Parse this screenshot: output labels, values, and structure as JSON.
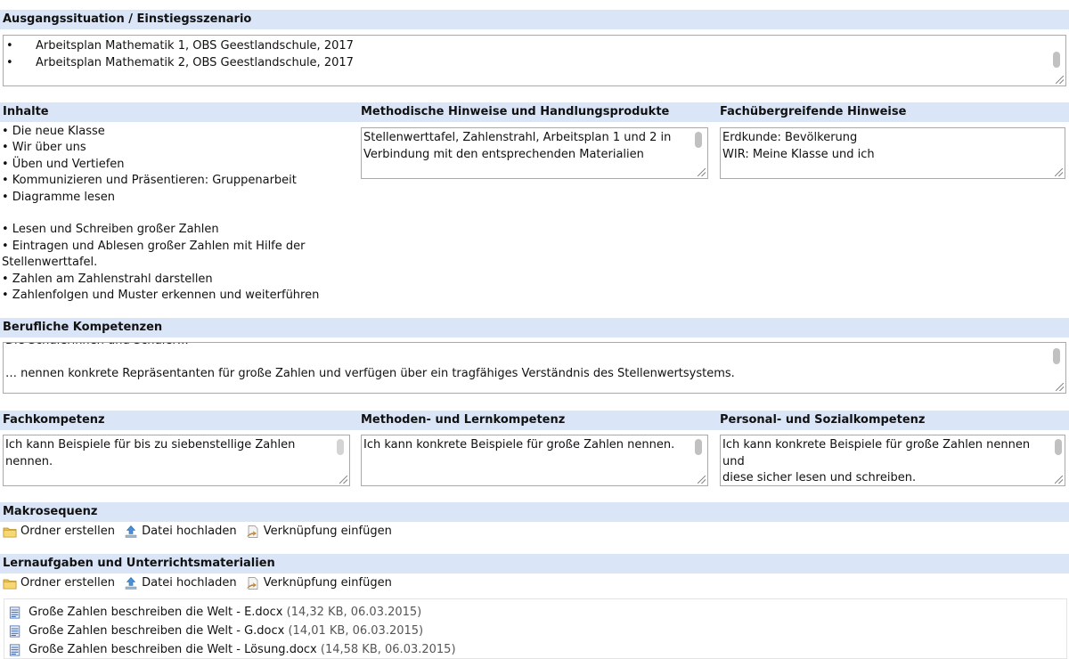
{
  "sections": {
    "ausgang": {
      "title": "Ausgangssituation / Einstiegsszenario",
      "items": [
        "Arbeitsplan Mathematik 1, OBS Geestlandschule, 2017",
        "Arbeitsplan Mathematik 2, OBS Geestlandschule, 2017"
      ]
    },
    "inhalte": {
      "title": "Inhalte",
      "lines": [
        "• Die neue Klasse",
        "• Wir über uns",
        "• Üben und Vertiefen",
        "• Kommunizieren und Präsentieren: Gruppenarbeit",
        "• Diagramme lesen",
        "",
        "• Lesen und Schreiben großer Zahlen",
        "• Eintragen und Ablesen großer Zahlen mit Hilfe der",
        "Stellenwerttafel.",
        "• Zahlen am Zahlenstrahl darstellen",
        "• Zahlenfolgen und Muster erkennen und weiterführen"
      ]
    },
    "methodisch": {
      "title": "Methodische Hinweise und Handlungsprodukte",
      "lines": [
        "Stellenwerttafel, Zahlenstrahl, Arbeitsplan 1 und 2 in",
        "Verbindung mit den entsprechenden Materialien"
      ]
    },
    "fachuebergreifend": {
      "title": "Fachübergreifende Hinweise",
      "lines": [
        "Erdkunde: Bevölkerung",
        "WIR: Meine Klasse und ich"
      ]
    },
    "beruflich": {
      "title": "Berufliche Kompetenzen",
      "lines": [
        "Die Schülerinnen und Schüler…",
        "",
        "… nennen konkrete Repräsentanten für große Zahlen und verfügen über ein tragfähiges Verständnis des Stellenwertsystems."
      ]
    },
    "fach": {
      "title": "Fachkompetenz",
      "lines": [
        "Ich kann Beispiele für bis zu siebenstellige Zahlen",
        "nennen."
      ]
    },
    "methoden": {
      "title": "Methoden- und Lernkompetenz",
      "lines": [
        "Ich kann konkrete Beispiele für große Zahlen nennen."
      ]
    },
    "personal": {
      "title": "Personal- und Sozialkompetenz",
      "lines": [
        "Ich kann konkrete Beispiele für große Zahlen nennen und",
        "diese sicher lesen und schreiben."
      ]
    },
    "makro": {
      "title": "Makrosequenz"
    },
    "lernaufgaben": {
      "title": "Lernaufgaben und Unterrichtsmaterialien",
      "files": [
        {
          "name": "Große Zahlen beschreiben die Welt - E.docx",
          "meta": "(14,32 KB, 06.03.2015)"
        },
        {
          "name": "Große Zahlen beschreiben die Welt - G.docx",
          "meta": "(14,01 KB, 06.03.2015)"
        },
        {
          "name": "Große Zahlen beschreiben die Welt - Lösung.docx",
          "meta": "(14,58 KB, 06.03.2015)"
        }
      ]
    }
  },
  "toolbar": {
    "folder": "Ordner erstellen",
    "upload": "Datei hochladen",
    "link": "Verknüpfung einfügen"
  },
  "icons": {
    "folder": "folder-icon",
    "upload": "upload-icon",
    "link": "link-icon",
    "file": "docx-file-icon"
  },
  "colors": {
    "header_band": "#dae6f8",
    "border": "#a9a9a9",
    "folder": "#f0c04a"
  }
}
